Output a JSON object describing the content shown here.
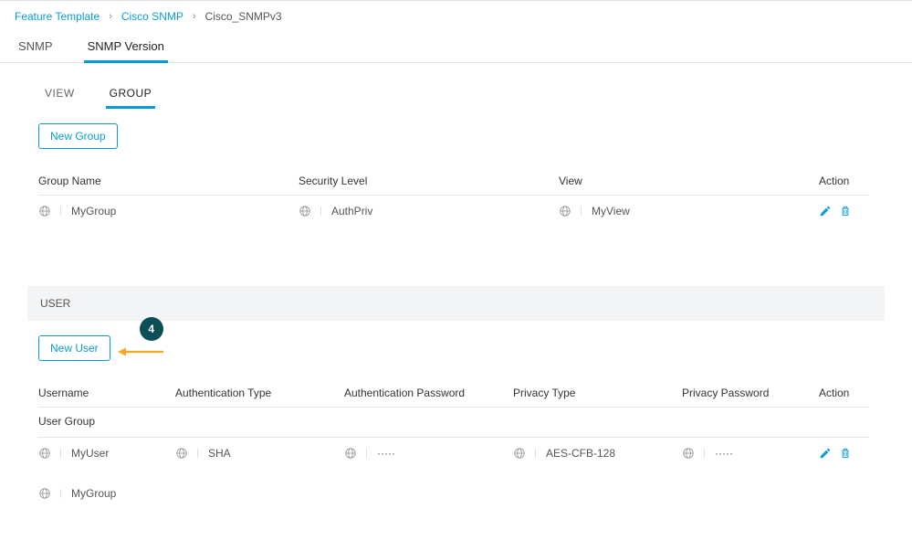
{
  "breadcrumb": {
    "items": [
      {
        "label": "Feature Template",
        "link": true
      },
      {
        "label": "Cisco SNMP",
        "link": true
      },
      {
        "label": "Cisco_SNMPv3",
        "link": false
      }
    ]
  },
  "main_tabs": {
    "items": [
      {
        "label": "SNMP",
        "active": false
      },
      {
        "label": "SNMP Version",
        "active": true
      }
    ]
  },
  "sub_tabs": {
    "items": [
      {
        "label": "VIEW",
        "active": false
      },
      {
        "label": "GROUP",
        "active": true
      }
    ]
  },
  "group": {
    "new_button": "New Group",
    "headers": {
      "name": "Group Name",
      "security": "Security Level",
      "view": "View",
      "action": "Action"
    },
    "rows": [
      {
        "name": "MyGroup",
        "security": "AuthPriv",
        "view": "MyView"
      }
    ]
  },
  "user_section": {
    "title": "USER",
    "new_button": "New User",
    "step": "4",
    "headers": {
      "username": "Username",
      "auth_type": "Authentication Type",
      "auth_pwd": "Authentication Password",
      "priv_type": "Privacy Type",
      "priv_pwd": "Privacy Password",
      "action": "Action",
      "user_group": "User Group"
    },
    "rows": [
      {
        "username": "MyUser",
        "auth_type": "SHA",
        "auth_pwd": "·····",
        "priv_type": "AES-CFB-128",
        "priv_pwd": "·····",
        "user_group": "MyGroup"
      }
    ]
  }
}
